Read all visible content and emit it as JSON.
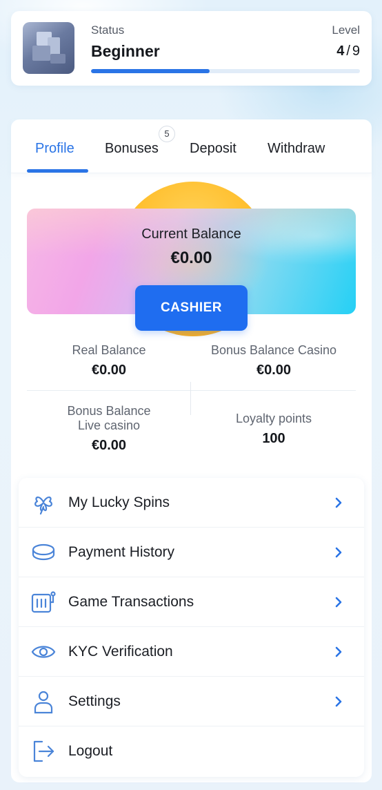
{
  "status_card": {
    "status_label": "Status",
    "status_value": "Beginner",
    "level_label": "Level",
    "level_current": "4",
    "level_separator": "/",
    "level_total": "9",
    "progress_fraction": 0.44
  },
  "tabs": [
    {
      "label": "Profile",
      "active": true
    },
    {
      "label": "Bonuses",
      "badge": "5"
    },
    {
      "label": "Deposit"
    },
    {
      "label": "Withdraw"
    }
  ],
  "balance": {
    "label": "Current Balance",
    "value": "€0.00",
    "cashier_label": "CASHIER"
  },
  "stats": [
    {
      "label": "Real Balance",
      "value": "€0.00"
    },
    {
      "label": "Bonus Balance Casino",
      "value": "€0.00"
    },
    {
      "label": "Bonus Balance Live casino",
      "value": "€0.00"
    },
    {
      "label": "Loyalty points",
      "value": "100"
    }
  ],
  "menu": [
    {
      "label": "My Lucky Spins",
      "icon": "clover-icon",
      "chevron": true
    },
    {
      "label": "Payment History",
      "icon": "coins-icon",
      "chevron": true
    },
    {
      "label": "Game Transactions",
      "icon": "slot-machine-icon",
      "chevron": true
    },
    {
      "label": "KYC Verification",
      "icon": "eye-icon",
      "chevron": true
    },
    {
      "label": "Settings",
      "icon": "user-icon",
      "chevron": true
    },
    {
      "label": "Logout",
      "icon": "logout-icon",
      "chevron": false
    }
  ],
  "colors": {
    "accent": "#2a74e6",
    "button": "#1f6df0",
    "icon": "#4a84d8"
  }
}
